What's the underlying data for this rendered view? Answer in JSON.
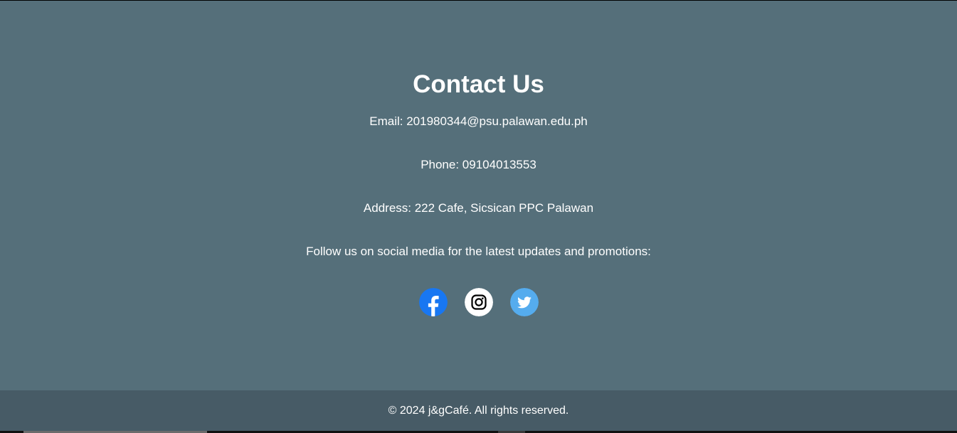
{
  "contact": {
    "title": "Contact Us",
    "email": "Email: 201980344@psu.palawan.edu.ph",
    "phone": "Phone: 09104013553",
    "address": "Address: 222 Cafe, Sicsican PPC Palawan",
    "follow": "Follow us on social media for the latest updates and promotions:"
  },
  "social": [
    {
      "icon": "facebook-icon",
      "color": "#1877f2"
    },
    {
      "icon": "instagram-icon",
      "color": "#ffffff"
    },
    {
      "icon": "twitter-icon",
      "color": "#55acee"
    }
  ],
  "footer": {
    "copyright": "© 2024 j&gCafé. All rights reserved."
  },
  "colors": {
    "section_bg": "#556f7a",
    "footer_bg": "#475b66",
    "text": "#ffffff"
  }
}
